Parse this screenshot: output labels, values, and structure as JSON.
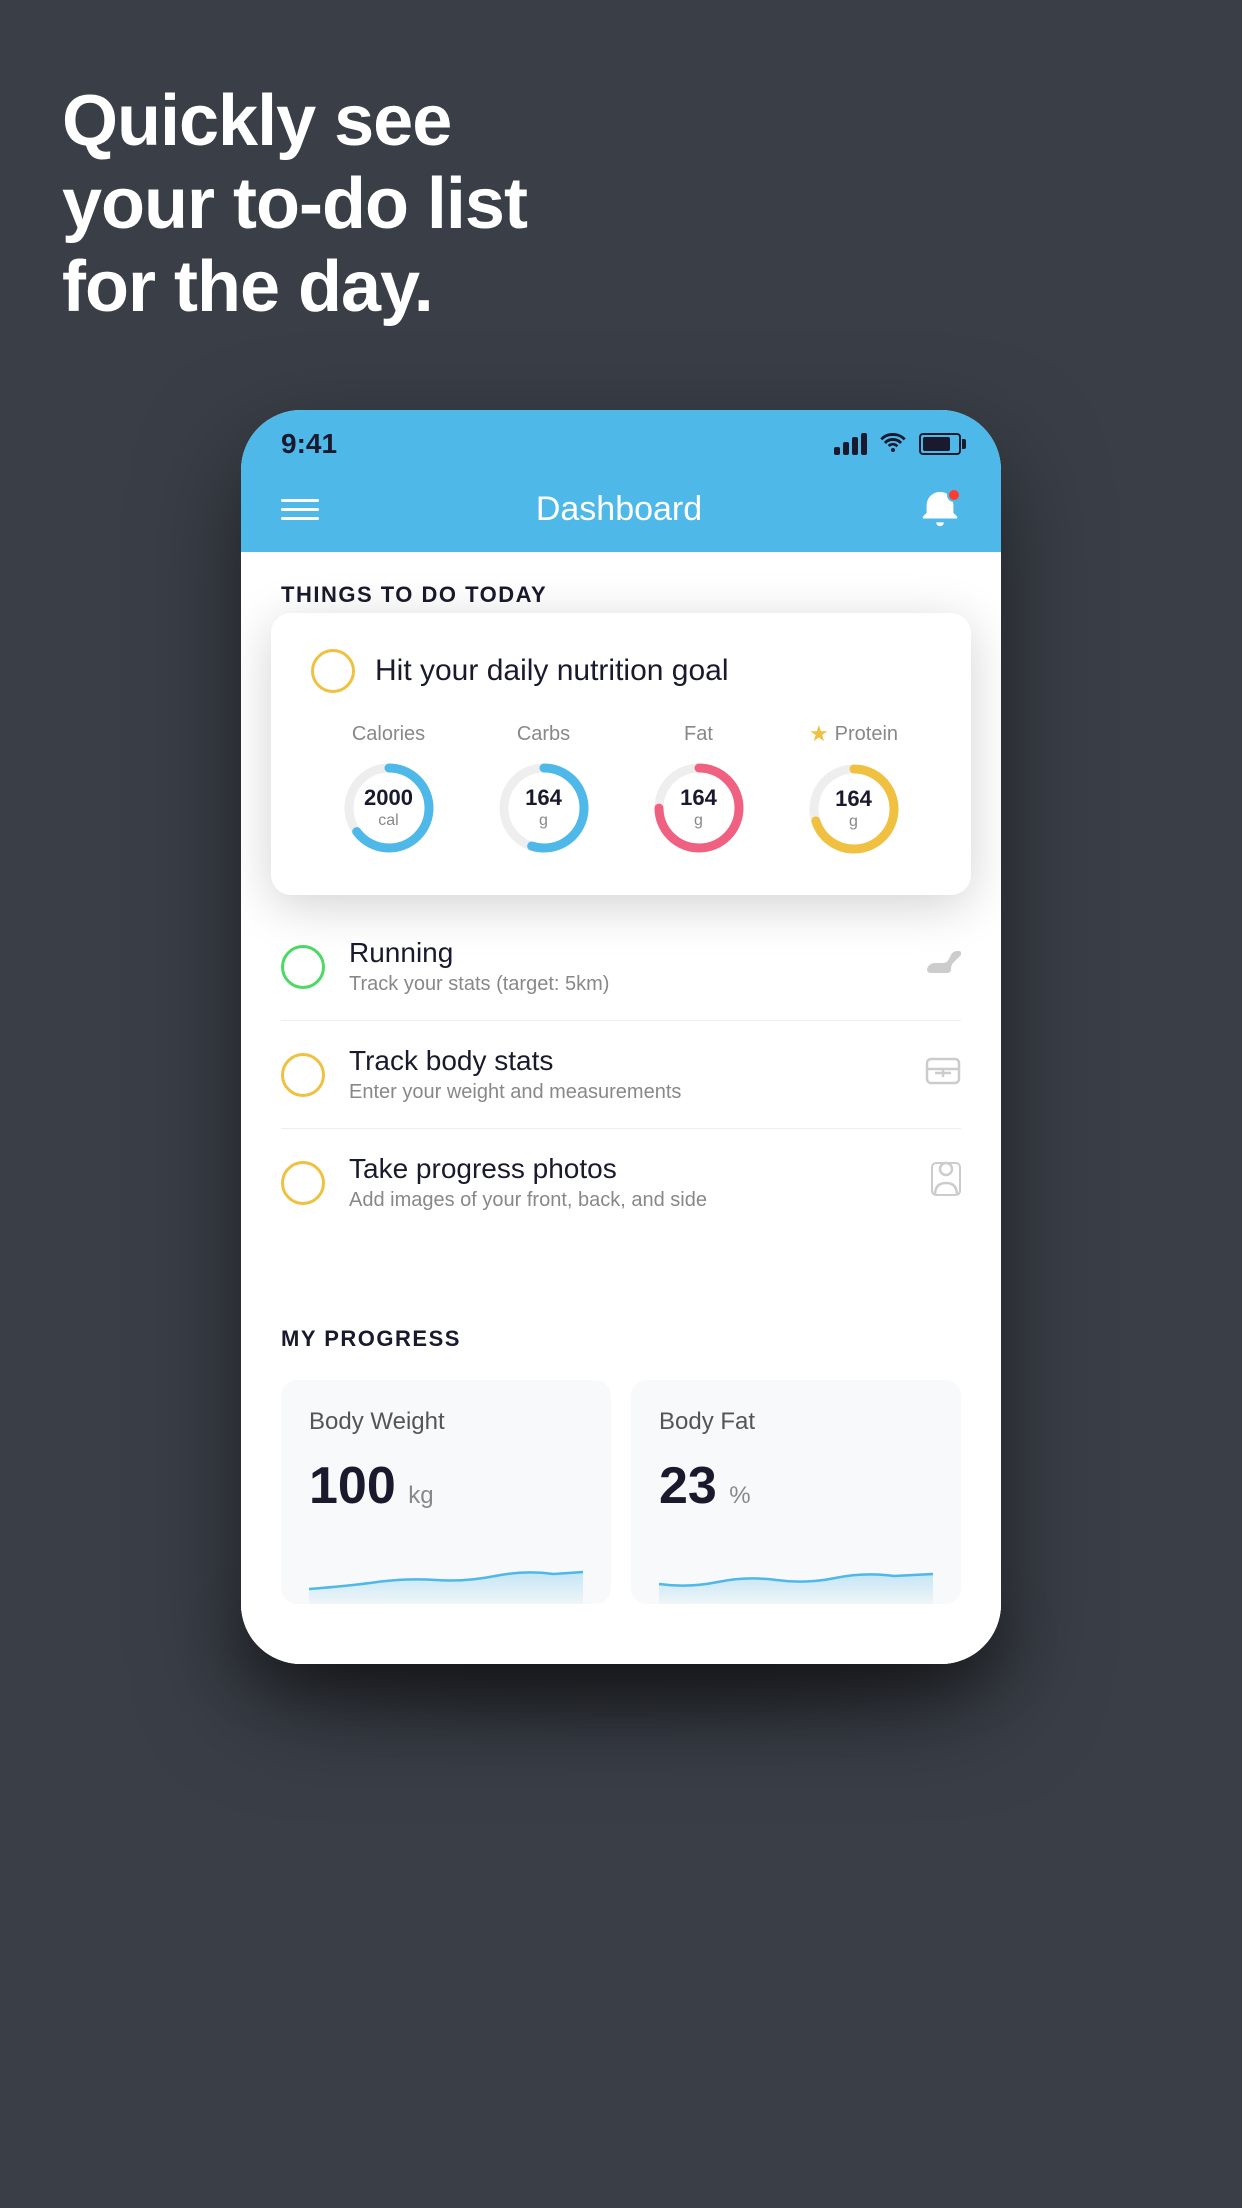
{
  "hero": {
    "line1": "Quickly see",
    "line2": "your to-do list",
    "line3": "for the day."
  },
  "phone": {
    "statusBar": {
      "time": "9:41"
    },
    "navBar": {
      "title": "Dashboard"
    },
    "thingsToDo": {
      "sectionHeader": "THINGS TO DO TODAY",
      "nutritionCard": {
        "title": "Hit your daily nutrition goal",
        "stats": [
          {
            "label": "Calories",
            "value": "2000",
            "unit": "cal",
            "color": "#4eb8e8",
            "progress": 0.65
          },
          {
            "label": "Carbs",
            "value": "164",
            "unit": "g",
            "color": "#4eb8e8",
            "progress": 0.55
          },
          {
            "label": "Fat",
            "value": "164",
            "unit": "g",
            "color": "#f06080",
            "progress": 0.75
          },
          {
            "label": "Protein",
            "value": "164",
            "unit": "g",
            "color": "#f0c040",
            "progress": 0.7,
            "starred": true
          }
        ]
      },
      "items": [
        {
          "title": "Running",
          "subtitle": "Track your stats (target: 5km)",
          "circleColor": "green",
          "icon": "shoe"
        },
        {
          "title": "Track body stats",
          "subtitle": "Enter your weight and measurements",
          "circleColor": "yellow",
          "icon": "scale"
        },
        {
          "title": "Take progress photos",
          "subtitle": "Add images of your front, back, and side",
          "circleColor": "yellow",
          "icon": "person"
        }
      ]
    },
    "myProgress": {
      "sectionHeader": "MY PROGRESS",
      "cards": [
        {
          "title": "Body Weight",
          "value": "100",
          "unit": "kg"
        },
        {
          "title": "Body Fat",
          "value": "23",
          "unit": "%"
        }
      ]
    }
  }
}
